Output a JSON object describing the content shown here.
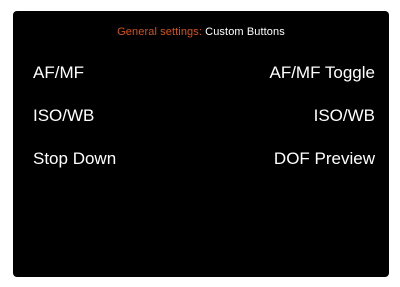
{
  "header": {
    "category": "General settings:",
    "title": "Custom Buttons",
    "category_color": "#d2521f"
  },
  "rows": [
    {
      "label": "AF/MF",
      "value": "AF/MF Toggle"
    },
    {
      "label": "ISO/WB",
      "value": "ISO/WB"
    },
    {
      "label": "Stop Down",
      "value": "DOF Preview"
    }
  ]
}
